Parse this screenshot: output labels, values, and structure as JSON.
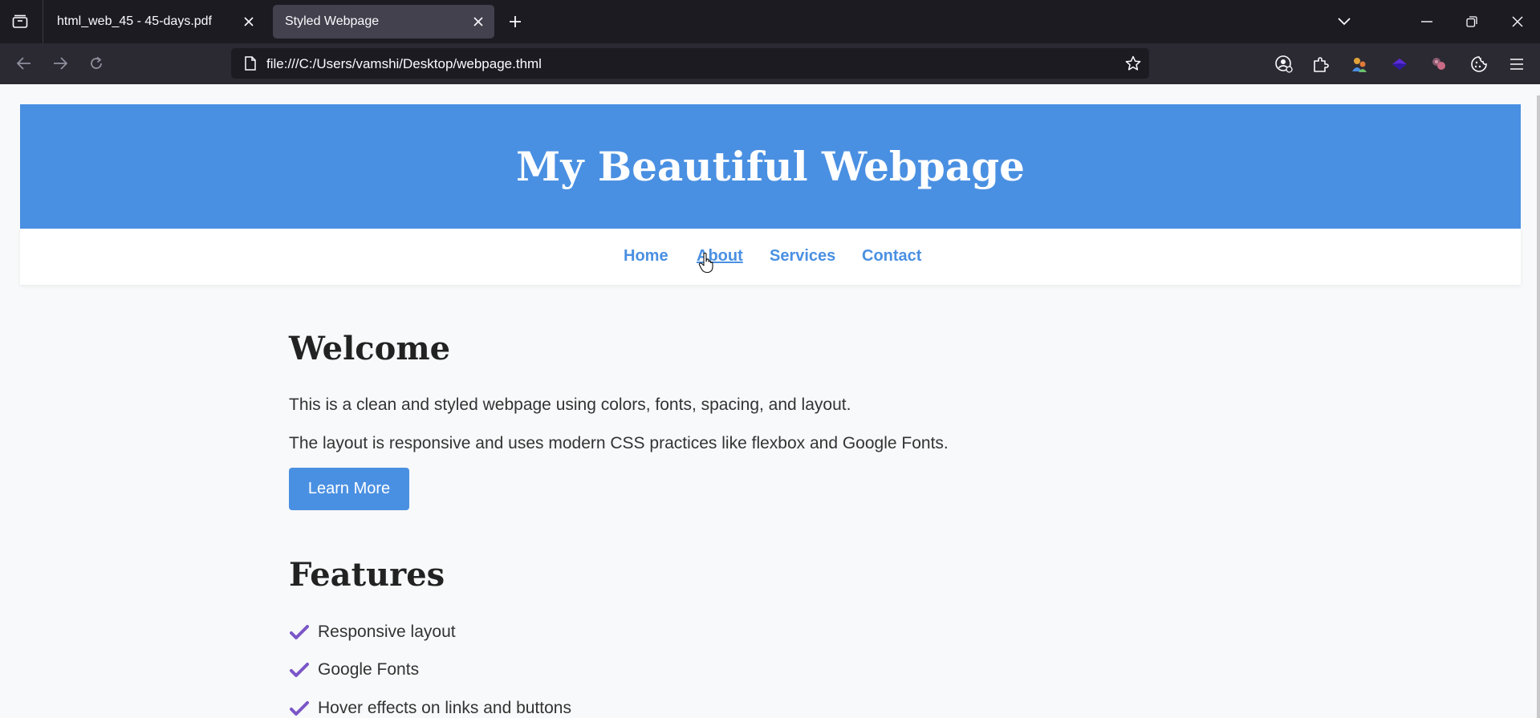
{
  "browser": {
    "tabs": [
      {
        "title": "html_web_45 - 45-days.pdf",
        "active": false
      },
      {
        "title": "Styled Webpage",
        "active": true
      }
    ],
    "url": "file:///C:/Users/vamshi/Desktop/webpage.thml"
  },
  "page": {
    "header_title": "My Beautiful Webpage",
    "nav": [
      "Home",
      "About",
      "Services",
      "Contact"
    ],
    "nav_hovered": "About",
    "welcome": {
      "heading": "Welcome",
      "paragraphs": [
        "This is a clean and styled webpage using colors, fonts, spacing, and layout.",
        "The layout is responsive and uses modern CSS practices like flexbox and Google Fonts."
      ],
      "button": "Learn More"
    },
    "features": {
      "heading": "Features",
      "items": [
        "Responsive layout",
        "Google Fonts",
        "Hover effects on links and buttons"
      ]
    }
  },
  "colors": {
    "accent": "#4a90e2",
    "check": "#7b57c8",
    "page_bg": "#f8f9fa"
  }
}
